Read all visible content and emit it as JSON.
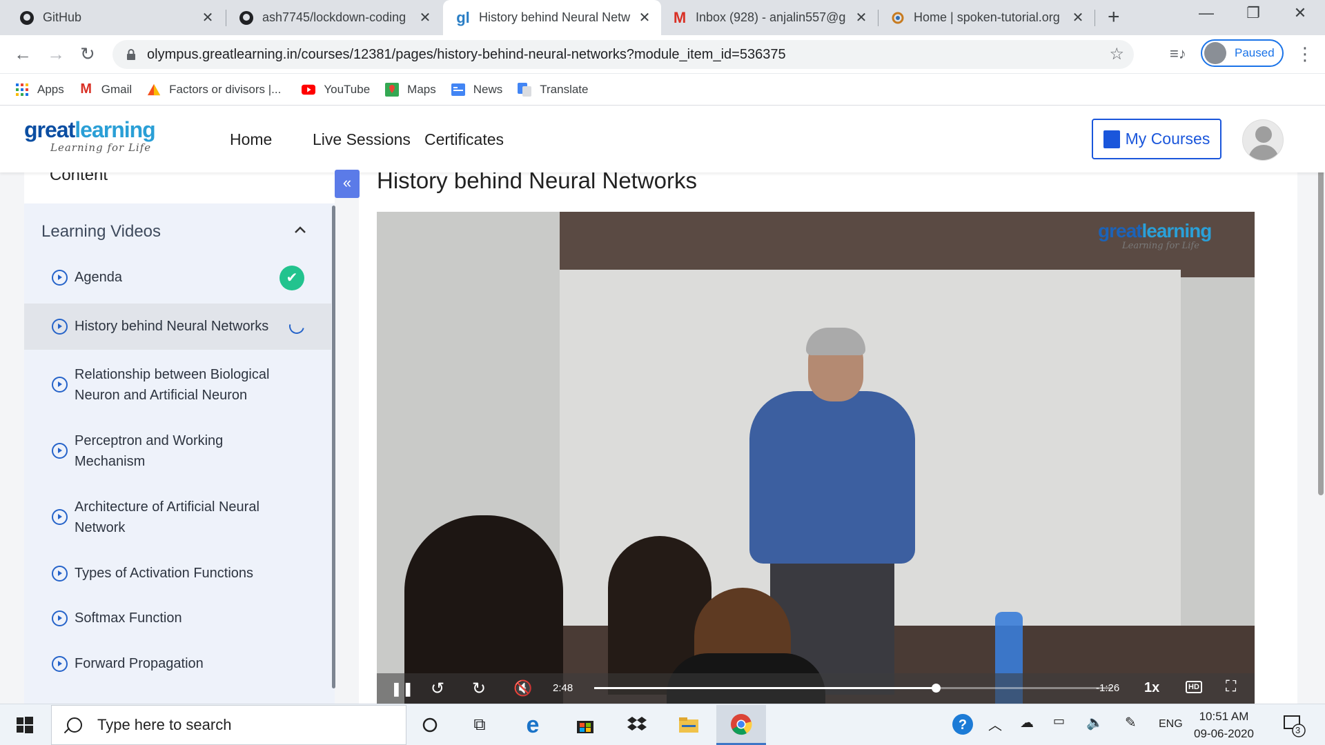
{
  "browser": {
    "tabs": [
      {
        "title": "GitHub",
        "icon": "github-icon"
      },
      {
        "title": "ash7745/lockdown-coding",
        "icon": "github-icon"
      },
      {
        "title": "History behind Neural Netw",
        "icon": "greatlearning-icon",
        "active": true
      },
      {
        "title": "Inbox (928) - anjalin557@g",
        "icon": "gmail-icon"
      },
      {
        "title": "Home | spoken-tutorial.org",
        "icon": "spoken-tutorial-icon"
      }
    ],
    "new_tab": "+",
    "url": "olympus.greatlearning.in/courses/12381/pages/history-behind-neural-networks?module_item_id=536375",
    "profile_status": "Paused",
    "bookmarks": [
      {
        "label": "Apps",
        "icon": "apps-grid-icon"
      },
      {
        "label": "Gmail",
        "icon": "gmail-icon"
      },
      {
        "label": "Factors or divisors |...",
        "icon": "triangle-icon"
      },
      {
        "label": "YouTube",
        "icon": "youtube-icon"
      },
      {
        "label": "Maps",
        "icon": "maps-icon"
      },
      {
        "label": "News",
        "icon": "news-icon"
      },
      {
        "label": "Translate",
        "icon": "translate-icon"
      }
    ]
  },
  "site": {
    "logo_main_a": "great",
    "logo_main_b": "learning",
    "logo_tagline": "Learning for Life",
    "nav": [
      "Home",
      "Live Sessions",
      "Certificates"
    ],
    "my_courses": "My Courses"
  },
  "sidebar": {
    "heading": "Content",
    "section": "Learning Videos",
    "items": [
      {
        "label": "Agenda",
        "status": "completed"
      },
      {
        "label": "History behind Neural Networks",
        "status": "in-progress"
      },
      {
        "label": "Relationship between Biological Neuron and Artificial Neuron"
      },
      {
        "label": "Perceptron and Working Mechanism"
      },
      {
        "label": "Architecture of Artificial Neural Network"
      },
      {
        "label": "Types of Activation Functions"
      },
      {
        "label": "Softmax Function"
      },
      {
        "label": "Forward Propagation"
      }
    ]
  },
  "main": {
    "title": "History behind Neural Networks",
    "video": {
      "watermark_a": "great",
      "watermark_b": "learning",
      "watermark_tagline": "Learning for Life",
      "elapsed": "2:48",
      "remaining": "-1:26",
      "progress": 0.66,
      "speed": "1x",
      "quality": "HD"
    }
  },
  "taskbar": {
    "search_placeholder": "Type here to search",
    "language": "ENG",
    "time": "10:51 AM",
    "date": "09-06-2020",
    "notifications": "3"
  },
  "colors": {
    "brand_dark": "#0b4ea2",
    "brand_light": "#2a9fd6",
    "accent": "#1a56db",
    "check": "#22c38e"
  }
}
